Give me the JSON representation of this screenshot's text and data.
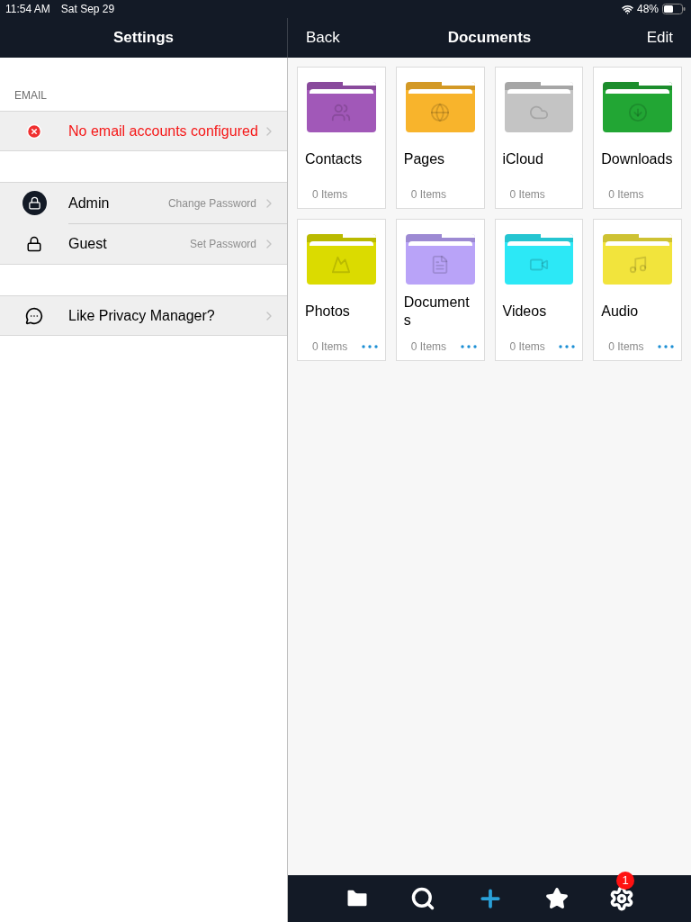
{
  "status_bar": {
    "time": "11:54 AM",
    "date": "Sat Sep 29",
    "battery": "48%"
  },
  "settings": {
    "title": "Settings",
    "section_label": "EMAIL",
    "email_row": {
      "label": "No email accounts configured"
    },
    "user_rows": [
      {
        "kind": "admin",
        "label": "Admin",
        "action": "Change Password"
      },
      {
        "kind": "guest",
        "label": "Guest",
        "action": "Set Password"
      }
    ],
    "feedback_row": {
      "label": "Like Privacy Manager?"
    }
  },
  "documents": {
    "back": "Back",
    "title": "Documents",
    "edit": "Edit",
    "folders": [
      {
        "kind": "contacts",
        "name": "Contacts",
        "count": "0 Items",
        "color": "#a158b8",
        "more": false
      },
      {
        "kind": "pages",
        "name": "Pages",
        "count": "0 Items",
        "color": "#f8b42c",
        "more": false
      },
      {
        "kind": "icloud",
        "name": "iCloud",
        "count": "0 Items",
        "color": "#c4c4c4",
        "more": false
      },
      {
        "kind": "downloads",
        "name": "Downloads",
        "count": "0 Items",
        "color": "#22a634",
        "more": false
      },
      {
        "kind": "photos",
        "name": "Photos",
        "count": "0 Items",
        "color": "#dbdb00",
        "more": true
      },
      {
        "kind": "documents",
        "name": "Documents",
        "count": "0 Items",
        "color": "#b9a3f8",
        "more": true
      },
      {
        "kind": "videos",
        "name": "Videos",
        "count": "0 Items",
        "color": "#2ce8f6",
        "more": true
      },
      {
        "kind": "audio",
        "name": "Audio",
        "count": "0 Items",
        "color": "#f2e43c",
        "more": true
      }
    ]
  },
  "toolbar": {
    "settings_badge": "1"
  }
}
